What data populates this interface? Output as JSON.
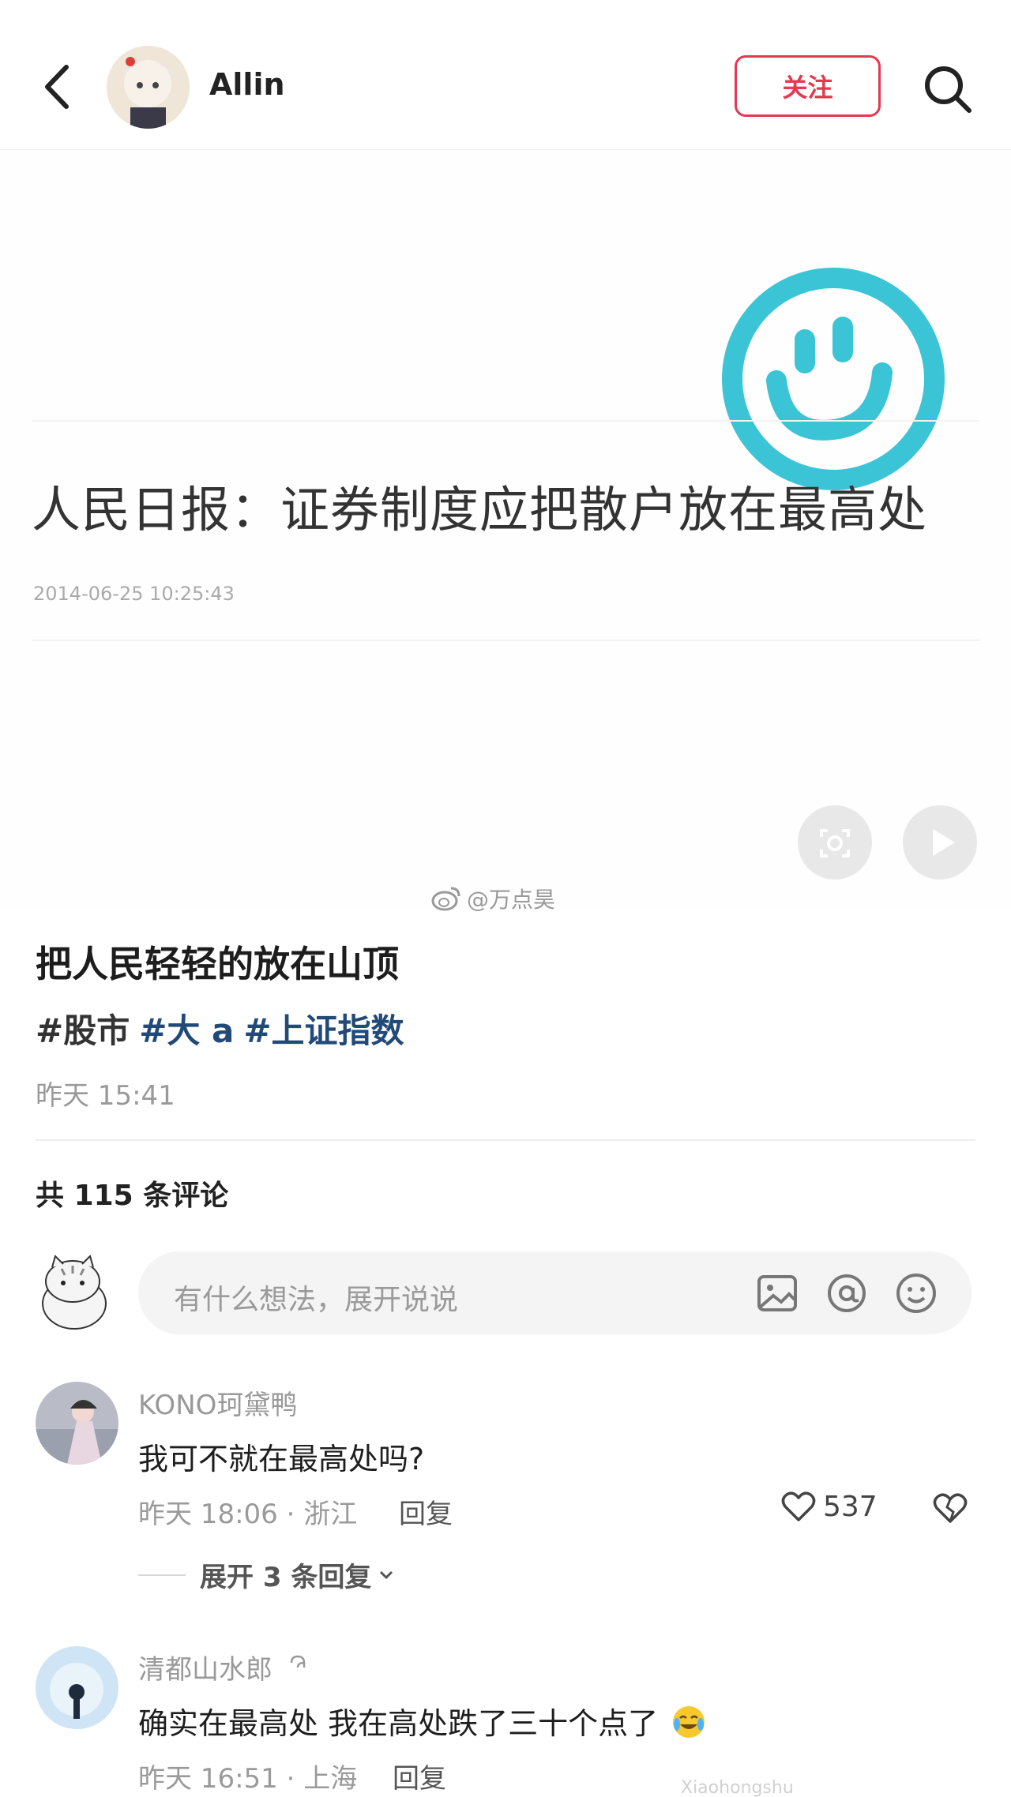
{
  "header": {
    "author": "Allin",
    "follow_label": "关注"
  },
  "image": {
    "headline": "人民日报：证券制度应把散户放在最高处",
    "date": "2014-06-25 10:25:43",
    "watermark": "@万点昊"
  },
  "post": {
    "title": "把人民轻轻的放在山顶",
    "tags": [
      "#股市",
      "#大 a",
      "#上证指数"
    ],
    "time": "昨天 15:41"
  },
  "comments_header": {
    "prefix": "共",
    "count": "115",
    "suffix": "条评论"
  },
  "composer": {
    "placeholder": "有什么想法，展开说说"
  },
  "comments": [
    {
      "user": "KONO珂黛鸭",
      "text": "我可不就在最高处吗?",
      "meta": "昨天 18:06 · 浙江",
      "reply_label": "回复",
      "likes": "537",
      "expand": "展开 3 条回复"
    },
    {
      "user": "清都山水郎",
      "text": "确实在最高处 我在高处跌了三十个点了",
      "meta": "昨天 16:51 · 上海",
      "reply_label": "回复"
    }
  ],
  "site_mark": "Xiaohongshu",
  "colors": {
    "accent": "#e23a50",
    "tag_blue": "#214a78",
    "smiley": "#3bc4d6"
  }
}
